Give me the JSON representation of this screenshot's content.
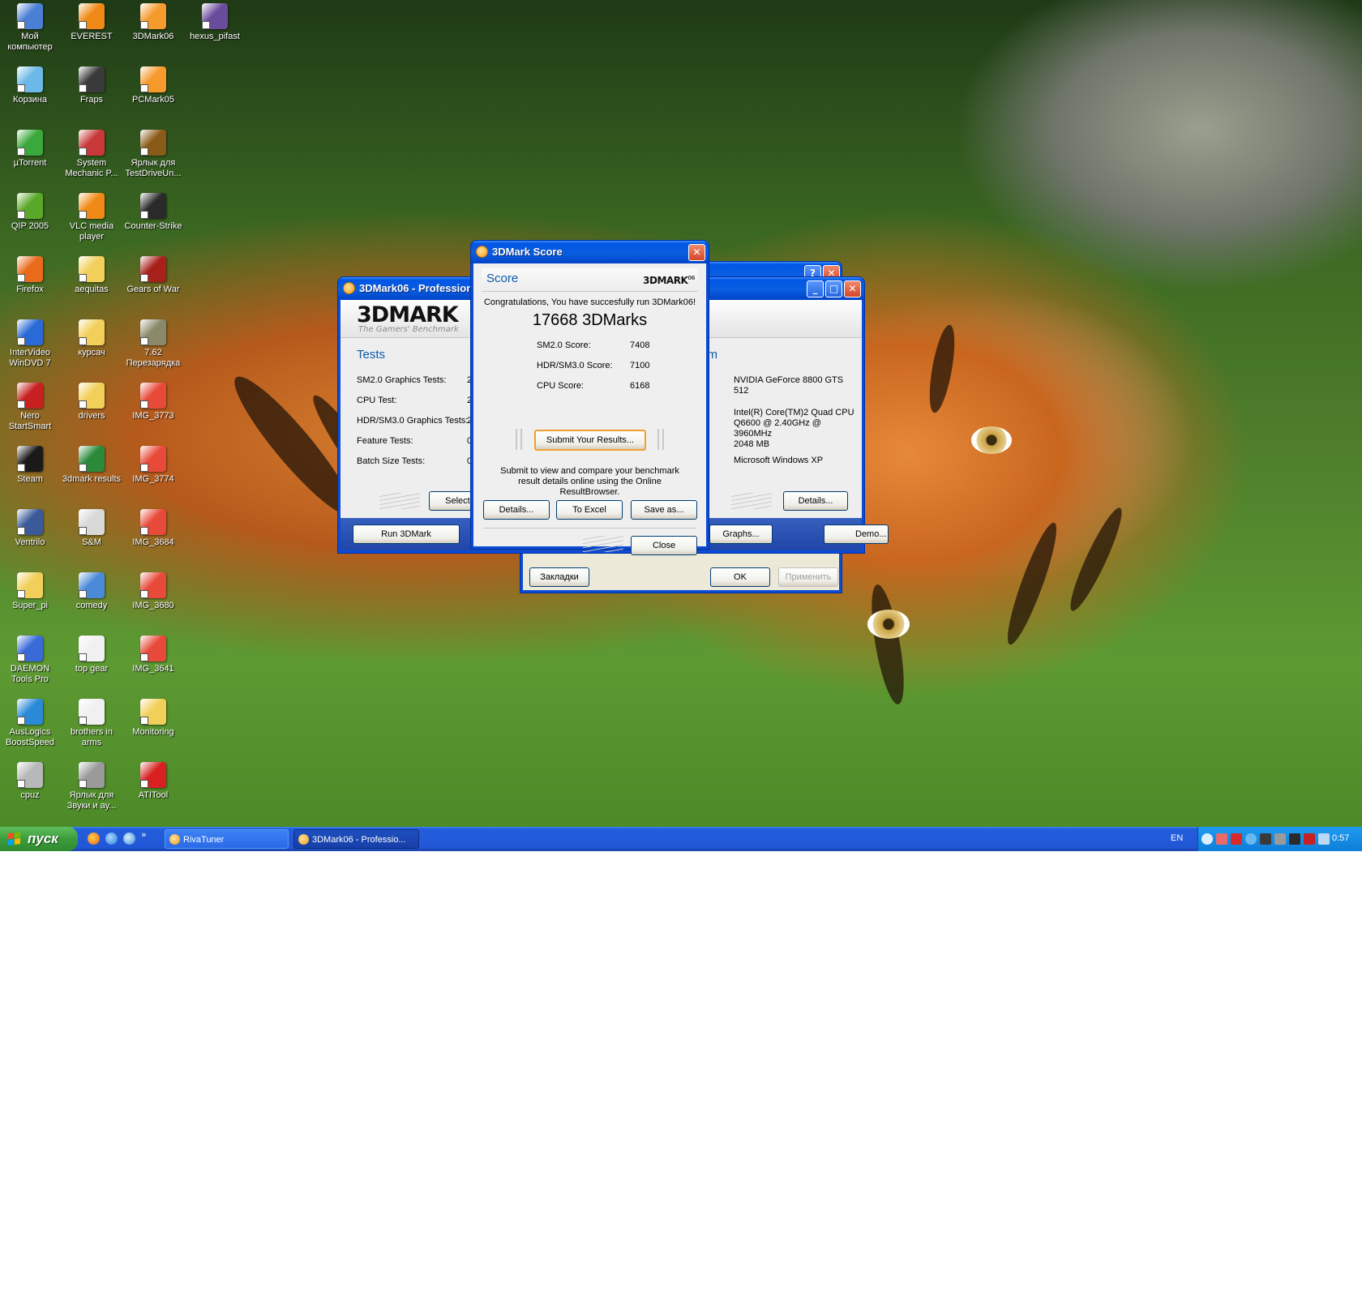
{
  "desktop": {
    "icons": [
      {
        "label": "Мой компьютер",
        "color": "#4a7fd4"
      },
      {
        "label": "EVEREST",
        "color": "#f08a16"
      },
      {
        "label": "3DMark06",
        "color": "#f59a2c"
      },
      {
        "label": "hexus_pifast",
        "color": "#6a4c9c"
      },
      {
        "label": "Корзина",
        "color": "#6cb8e8"
      },
      {
        "label": "Fraps",
        "color": "#3a3a3a"
      },
      {
        "label": "PCMark05",
        "color": "#f59a2c"
      },
      {
        "label": "µTorrent",
        "color": "#3aa83a"
      },
      {
        "label": "System Mechanic P...",
        "color": "#c83838"
      },
      {
        "label": "Ярлык для TestDriveUn...",
        "color": "#8a5a18"
      },
      {
        "label": "QIP 2005",
        "color": "#5aa82a"
      },
      {
        "label": "VLC media player",
        "color": "#f08a16"
      },
      {
        "label": "Counter-Strike",
        "color": "#2a2a2a"
      },
      {
        "label": "Firefox",
        "color": "#e86a1a"
      },
      {
        "label": "aequitas",
        "color": "#f2cf5a"
      },
      {
        "label": "Gears of War",
        "color": "#a8201a"
      },
      {
        "label": "InterVideo WinDVD 7",
        "color": "#2a6ad8"
      },
      {
        "label": "курсач",
        "color": "#f2cf5a"
      },
      {
        "label": "7.62 Перезарядка",
        "color": "#8a8a6a"
      },
      {
        "label": "Nero StartSmart",
        "color": "#c82020"
      },
      {
        "label": "drivers",
        "color": "#f2cf5a"
      },
      {
        "label": "IMG_3773",
        "color": "#e84a3a"
      },
      {
        "label": "Steam",
        "color": "#1a1a1a"
      },
      {
        "label": "3dmark results",
        "color": "#2a8a3a"
      },
      {
        "label": "IMG_3774",
        "color": "#e84a3a"
      },
      {
        "label": "Ventrilo",
        "color": "#3a5a9a"
      },
      {
        "label": "S&M",
        "color": "#d8d8d8"
      },
      {
        "label": "IMG_3684",
        "color": "#e84a3a"
      },
      {
        "label": "Super_pi",
        "color": "#f2cf5a"
      },
      {
        "label": "comedy",
        "color": "#4a8ad8"
      },
      {
        "label": "IMG_3680",
        "color": "#e84a3a"
      },
      {
        "label": "DAEMON Tools Pro",
        "color": "#3a6ad8"
      },
      {
        "label": "top gear",
        "color": "#f0f0f0"
      },
      {
        "label": "IMG_3641",
        "color": "#e84a3a"
      },
      {
        "label": "AusLogics BoostSpeed",
        "color": "#2a8ad8"
      },
      {
        "label": "brothers in arms",
        "color": "#f0f0f0"
      },
      {
        "label": "Monitoring",
        "color": "#f2cf5a"
      },
      {
        "label": "cpuz",
        "color": "#b8b8b8"
      },
      {
        "label": "Ярлык для Звуки и ау...",
        "color": "#9a9a9a"
      },
      {
        "label": "ATITool",
        "color": "#d82020"
      }
    ]
  },
  "main_window": {
    "title": "3DMark06 - Professional",
    "logo": "3DMARK",
    "tagline": "The Gamers' Benchmark",
    "tests_heading": "Tests",
    "tests": [
      {
        "label": "SM2.0 Graphics Tests:",
        "value": "2"
      },
      {
        "label": "CPU Test:",
        "value": "2"
      },
      {
        "label": "HDR/SM3.0 Graphics Tests:",
        "value": "2"
      },
      {
        "label": "Feature Tests:",
        "value": "0"
      },
      {
        "label": "Batch Size Tests:",
        "value": "0"
      }
    ],
    "select_button": "Select...",
    "system_heading": "System",
    "system": [
      {
        "label": "GFX:",
        "value": "NVIDIA GeForce 8800 GTS 512"
      },
      {
        "label": "CPU:",
        "value": "Intel(R) Core(TM)2 Quad CPU Q6600 @ 2.40GHz @ 3960MHz"
      },
      {
        "label": "MEM:",
        "value": "2048 MB"
      },
      {
        "label": "OS:",
        "value": "Microsoft Windows XP"
      }
    ],
    "details_button": "Details...",
    "run_button": "Run 3DMark",
    "graphs_button": "Graphs...",
    "demo_button": "Demo..."
  },
  "back_dialog": {
    "bookmarks_button": "Закладки",
    "ok_button": "OK",
    "apply_button": "Применить"
  },
  "score_window": {
    "title": "3DMark Score",
    "heading": "Score",
    "logo": "3DMARK",
    "logo_sup": "06",
    "congrats": "Congratulations, You have succesfully run 3DMark06!",
    "total": "17668 3DMarks",
    "scores": [
      {
        "label": "SM2.0 Score:",
        "value": "7408"
      },
      {
        "label": "HDR/SM3.0 Score:",
        "value": "7100"
      },
      {
        "label": "CPU Score:",
        "value": "6168"
      }
    ],
    "submit_button": "Submit Your Results...",
    "submit_text": "Submit to view and compare your benchmark result details online using the Online ResultBrowser.",
    "details_button": "Details...",
    "excel_button": "To Excel",
    "save_button": "Save as...",
    "close_button": "Close"
  },
  "taskbar": {
    "start_label": "пуск",
    "more_glyph": "»",
    "tasks": [
      {
        "label": "RivaTuner",
        "active": false
      },
      {
        "label": "3DMark06 - Professio...",
        "active": true
      }
    ],
    "language": "EN",
    "clock": "0:57"
  }
}
